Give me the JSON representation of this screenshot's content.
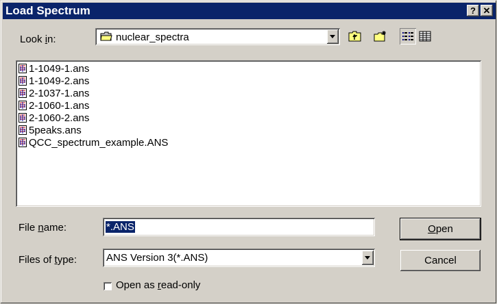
{
  "window": {
    "title": "Load Spectrum",
    "help_label": "?",
    "close_label": "✕"
  },
  "look_in": {
    "label_pre": "Look ",
    "label_ul": "i",
    "label_post": "n:",
    "value": "nuclear_spectra",
    "icon": "folder-icon"
  },
  "toolbar": {
    "up_icon": "up-one-level-icon",
    "new_folder_icon": "new-folder-icon",
    "list_view_icon": "list-view-icon",
    "details_view_icon": "details-view-icon",
    "active_view": "list"
  },
  "files": [
    "1-1049-1.ans",
    "1-1049-2.ans",
    "2-1037-1.ans",
    "2-1060-1.ans",
    "2-1060-2.ans",
    "5peaks.ans",
    "QCC_spectrum_example.ANS"
  ],
  "file_name": {
    "label_pre": "File ",
    "label_ul": "n",
    "label_post": "ame:",
    "value": "*.ANS"
  },
  "file_type": {
    "label_pre": "Files of ",
    "label_ul": "t",
    "label_post": "ype:",
    "value": "ANS Version 3(*.ANS)"
  },
  "read_only": {
    "label_pre": "Open as ",
    "label_ul": "r",
    "label_post": "ead-only",
    "checked": false
  },
  "buttons": {
    "open_ul": "O",
    "open_rest": "pen",
    "cancel": "Cancel"
  },
  "colors": {
    "titlebar": "#0a246a",
    "face": "#d4d0c8",
    "selection": "#0a246a"
  }
}
